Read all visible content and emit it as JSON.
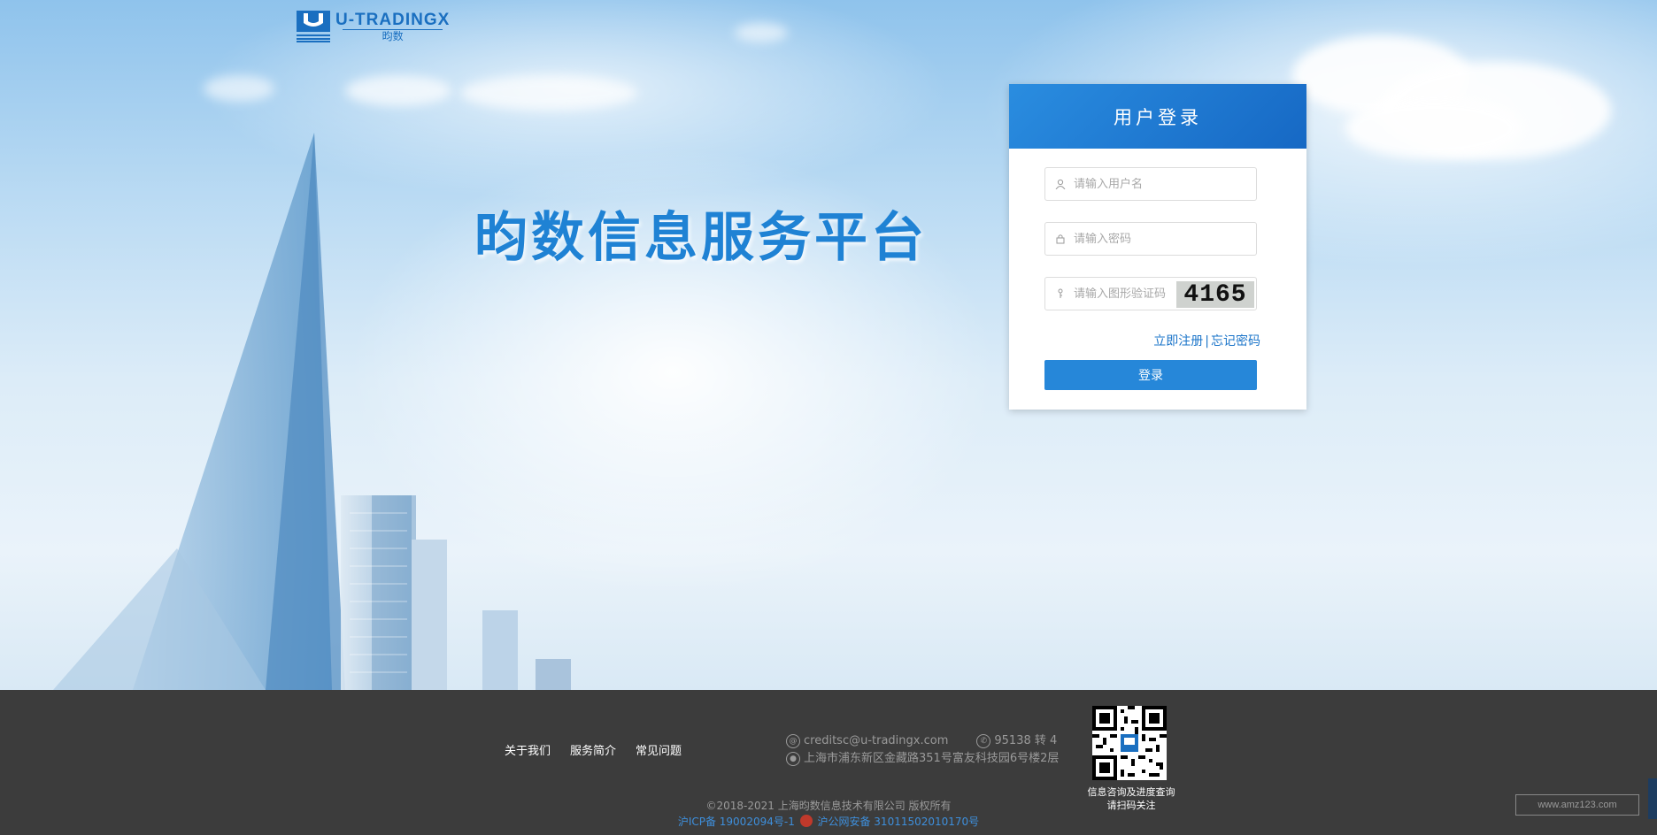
{
  "brand": {
    "logo_en": "U-TRADINGX",
    "logo_cn": "昀数"
  },
  "hero": {
    "headline": "昀数信息服务平台"
  },
  "login": {
    "title": "用户登录",
    "username_placeholder": "请输入用户名",
    "password_placeholder": "请输入密码",
    "captcha_placeholder": "请输入图形验证码",
    "captcha_text": "4165",
    "register_link": "立即注册",
    "separator": "|",
    "forgot_link": "忘记密码",
    "submit_label": "登录"
  },
  "footer": {
    "nav": [
      "关于我们",
      "服务简介",
      "常见问题"
    ],
    "email": "creditsc@u-tradingx.com",
    "phone": "95138 转 4",
    "address": "上海市浦东新区金藏路351号富友科技园6号楼2层",
    "qr_caption_line1": "信息咨询及进度查询",
    "qr_caption_line2": "请扫码关注",
    "copyright": "©2018-2021 上海昀数信息技术有限公司 版权所有",
    "icp": "沪ICP备 19002094号-1",
    "police": "沪公网安备 31011502010170号"
  },
  "watermark": "www.amz123.com",
  "colors": {
    "primary": "#2687d9",
    "headline": "#1f82d4",
    "footer_bg": "#3c3c3c",
    "link": "#1a74c9"
  }
}
